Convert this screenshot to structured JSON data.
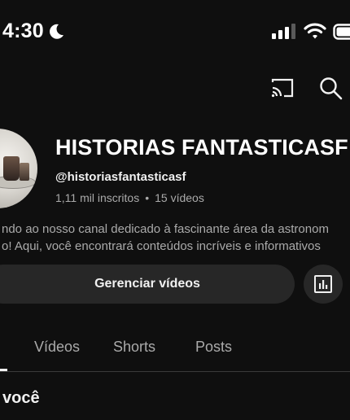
{
  "status_bar": {
    "time": "4:30",
    "icons": [
      "moon-icon",
      "signal-icon",
      "wifi-icon",
      "battery-icon"
    ]
  },
  "app_bar": {
    "icons": [
      "cast-icon",
      "search-icon"
    ]
  },
  "channel": {
    "name": "HISTORIAS FANTASTICASF",
    "handle": "@historiasfantasticasf",
    "subscribers": "1,11 mil inscritos",
    "separator": "•",
    "videos": "15 vídeos",
    "description_line1": "ndo ao nosso canal dedicado à fascinante área da astronom",
    "description_line2": "o! Aqui, você encontrará conteúdos incríveis e informativos"
  },
  "actions": {
    "manage_label": "Gerenciar vídeos",
    "analytics_icon": "analytics-icon"
  },
  "tabs": [
    {
      "label": "Vídeos"
    },
    {
      "label": "Shorts"
    },
    {
      "label": "Posts"
    }
  ],
  "section": {
    "heading": "você"
  },
  "colors": {
    "background": "#0f0f0f",
    "surface": "#272727",
    "text_primary": "#f1f1f1",
    "text_secondary": "#aaaaaa"
  }
}
